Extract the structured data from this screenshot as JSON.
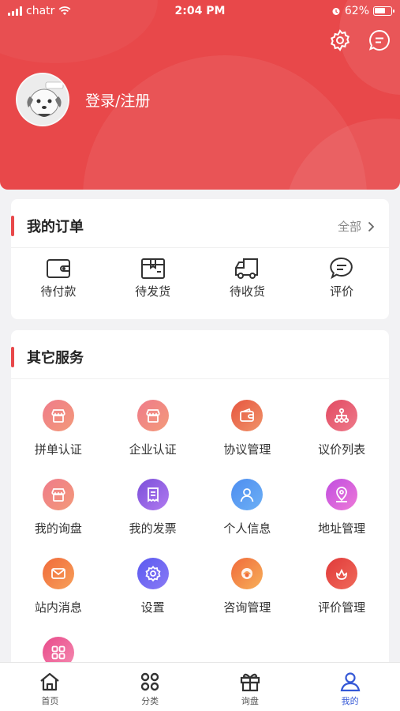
{
  "status_bar": {
    "carrier": "chatr",
    "time": "2:04 PM",
    "battery": "62%"
  },
  "header": {
    "login_text": "登录/注册"
  },
  "orders": {
    "title": "我的订单",
    "all_label": "全部",
    "items": [
      {
        "label": "待付款",
        "icon": "wallet-icon"
      },
      {
        "label": "待发货",
        "icon": "package-icon"
      },
      {
        "label": "待收货",
        "icon": "truck-icon"
      },
      {
        "label": "评价",
        "icon": "comment-icon"
      }
    ]
  },
  "services": {
    "title": "其它服务",
    "items": [
      {
        "label": "拼单认证",
        "icon": "store-icon",
        "colors": [
          "#ef7b8a",
          "#f39a7a"
        ]
      },
      {
        "label": "企业认证",
        "icon": "store-icon",
        "colors": [
          "#ef7b8a",
          "#f39a7a"
        ]
      },
      {
        "label": "协议管理",
        "icon": "wallet-icon",
        "colors": [
          "#e6553f",
          "#f0946a"
        ]
      },
      {
        "label": "议价列表",
        "icon": "hierarchy-icon",
        "colors": [
          "#e24a62",
          "#ee7a8a"
        ]
      },
      {
        "label": "我的询盘",
        "icon": "store-icon",
        "colors": [
          "#ef7b8a",
          "#f39a7a"
        ]
      },
      {
        "label": "我的发票",
        "icon": "receipt-icon",
        "colors": [
          "#7b4fd9",
          "#b07af0"
        ]
      },
      {
        "label": "个人信息",
        "icon": "user-icon",
        "colors": [
          "#4d8df0",
          "#6db0f5"
        ]
      },
      {
        "label": "地址管理",
        "icon": "location-icon",
        "colors": [
          "#c04de0",
          "#ee7ad8"
        ]
      },
      {
        "label": "站内消息",
        "icon": "mail-icon",
        "colors": [
          "#f06a3a",
          "#f7a05a"
        ]
      },
      {
        "label": "设置",
        "icon": "gear-icon",
        "colors": [
          "#5a5af0",
          "#8a7af5"
        ]
      },
      {
        "label": "咨询管理",
        "icon": "service-icon",
        "colors": [
          "#f06a3a",
          "#f7b05a"
        ]
      },
      {
        "label": "评价管理",
        "icon": "flower-icon",
        "colors": [
          "#e03a3a",
          "#f06a5a"
        ]
      },
      {
        "label": "",
        "icon": "grid-icon",
        "colors": [
          "#e84a8a",
          "#f58ab0"
        ]
      }
    ]
  },
  "tabbar": {
    "items": [
      {
        "label": "首页",
        "icon": "home-icon"
      },
      {
        "label": "分类",
        "icon": "category-icon"
      },
      {
        "label": "询盘",
        "icon": "gift-icon"
      },
      {
        "label": "我的",
        "icon": "profile-icon"
      }
    ],
    "active_color": "#3558d6"
  },
  "colors": {
    "brand": "#e8484a",
    "background": "#f2f2f4"
  }
}
